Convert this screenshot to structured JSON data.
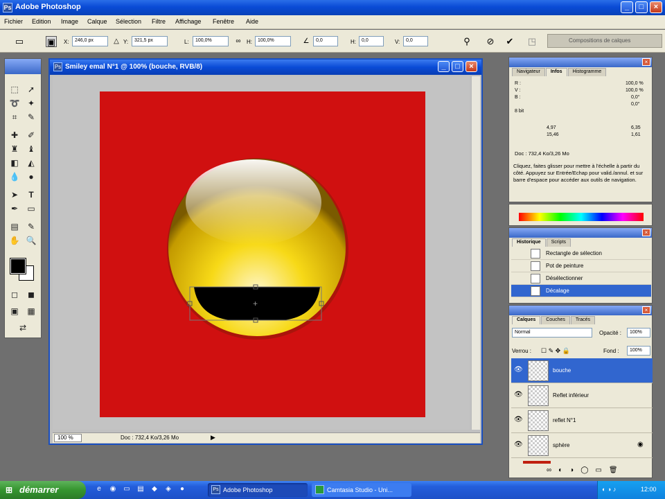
{
  "window": {
    "title": "Adobe Photoshop",
    "app_icon": "Ps"
  },
  "menu": [
    "Fichier",
    "Edition",
    "Image",
    "Calque",
    "Sélection",
    "Filtre",
    "Affichage",
    "Fenêtre",
    "Aide"
  ],
  "options_bar": {
    "x_label": "X:",
    "x_value": "246,0 px",
    "y_label": "Y:",
    "y_value": "321,5 px",
    "w_label": "L:",
    "w_value": "100,0%",
    "h_label": "H:",
    "h_value": "100,0%",
    "angle_value": "0,0",
    "hskew_label": "H:",
    "hskew_value": "0,0",
    "vskew_label": "V:",
    "vskew_value": "0,0",
    "compositions_tab": "Compositions de calques"
  },
  "document": {
    "title": "Smiley emal N°1 @ 100% (bouche, RVB/8)",
    "zoom": "100 %",
    "doc_info": "Doc : 732,4 Ko/3,26 Mo"
  },
  "info_panel": {
    "tabs": [
      "Navigateur",
      "Infos",
      "Histogramme"
    ],
    "rows": [
      {
        "l": "R :",
        "v": ""
      },
      {
        "l": "V :",
        "v": ""
      },
      {
        "l": "B :",
        "v": ""
      },
      {
        "l": "8 bit",
        "v": ""
      }
    ],
    "right_vals": [
      "100,0 %",
      "100,0 %",
      "0,0°",
      "0,0°"
    ],
    "xy_vals": [
      "4,97",
      "15,46"
    ],
    "wh_vals": [
      "6,35",
      "1,61"
    ],
    "doc_info": "Doc : 732,4 Ko/3,26 Mo",
    "hint": "Cliquez, faites glisser pour mettre à l'échelle à partir du côté. Appuyez sur Entrée/Echap pour valid./annul. et sur barre d'espace pour accéder aux outils de navigation."
  },
  "history_panel": {
    "tabs": [
      "Historique",
      "Scripts"
    ],
    "items": [
      "Rectangle de sélection",
      "Pot de peinture",
      "Désélectionner",
      "Décalage"
    ]
  },
  "layers_panel": {
    "tabs": [
      "Calques",
      "Couches",
      "Tracés"
    ],
    "blend_mode": "Normal",
    "opacity_label": "Opacité :",
    "opacity_value": "100%",
    "lock_label": "Verrou :",
    "fill_label": "Fond :",
    "fill_value": "100%",
    "layers": [
      "bouche",
      "Reflet inférieur",
      "reflet N°1",
      "sphère"
    ]
  },
  "taskbar": {
    "start": "démarrer",
    "tasks": [
      "Adobe Photoshop",
      "Camtasia Studio - Uni..."
    ],
    "clock": "12:00"
  },
  "colors": {
    "canvas_bg": "#d01010",
    "smiley_yellow": "#f7d917",
    "selection_blue": "#3166cf",
    "xp_blue": "#0a4bd6"
  },
  "icons": {
    "tools": [
      "marquee-icon",
      "move-icon",
      "lasso-icon",
      "magic-wand-icon",
      "crop-icon",
      "slice-icon",
      "heal-icon",
      "brush-icon",
      "stamp-icon",
      "history-brush-icon",
      "eraser-icon",
      "bucket-icon",
      "blur-icon",
      "dodge-icon",
      "path-select-icon",
      "type-icon",
      "pen-icon",
      "shape-icon",
      "notes-icon",
      "eyedropper-icon",
      "hand-icon",
      "zoom-icon"
    ]
  }
}
